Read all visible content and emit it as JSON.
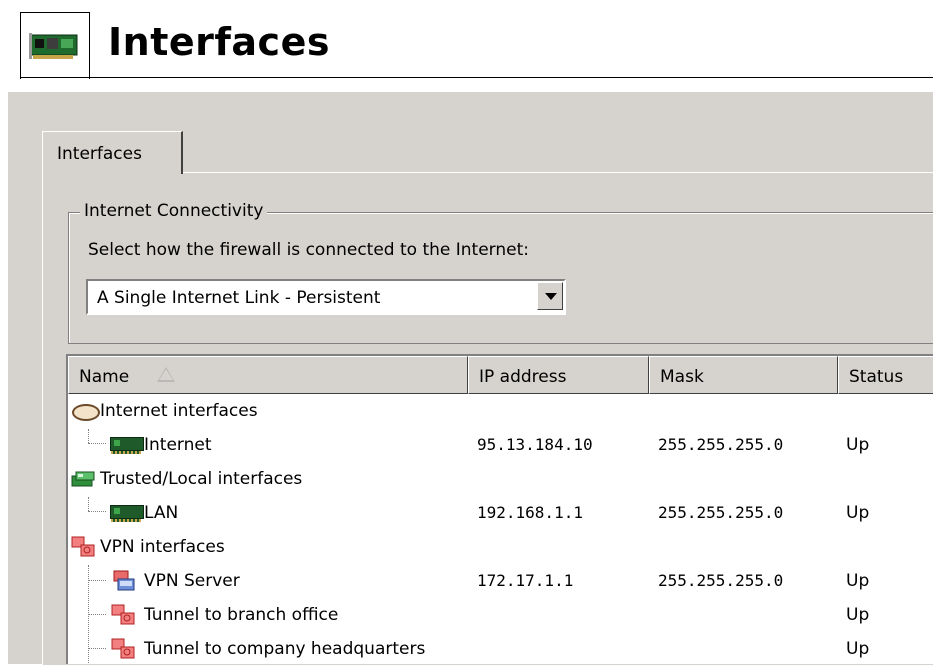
{
  "header": {
    "title": "Interfaces",
    "icon": "network-card-icon"
  },
  "tabs": [
    {
      "label": "Interfaces",
      "selected": true
    }
  ],
  "connectivity": {
    "legend": "Internet Connectivity",
    "prompt": "Select how the firewall is connected to the Internet:",
    "selected": "A Single Internet Link - Persistent"
  },
  "table": {
    "columns": [
      "Name",
      "IP address",
      "Mask",
      "Status"
    ],
    "sort": {
      "column": "Name",
      "direction": "ascending"
    },
    "rows": [
      {
        "name": "Internet interfaces",
        "ip": "",
        "mask": "",
        "status": "",
        "icon": "cloud-icon",
        "level": 0
      },
      {
        "name": "Internet",
        "ip": "95.13.184.10",
        "mask": "255.255.255.0",
        "status": "Up",
        "icon": "network-card-icon",
        "level": 1
      },
      {
        "name": "Trusted/Local interfaces",
        "ip": "",
        "mask": "",
        "status": "",
        "icon": "trusted-network-icon",
        "level": 0
      },
      {
        "name": "LAN",
        "ip": "192.168.1.1",
        "mask": "255.255.255.0",
        "status": "Up",
        "icon": "network-card-icon",
        "level": 1
      },
      {
        "name": "VPN interfaces",
        "ip": "",
        "mask": "",
        "status": "",
        "icon": "vpn-icon",
        "level": 0
      },
      {
        "name": "VPN Server",
        "ip": "172.17.1.1",
        "mask": "255.255.255.0",
        "status": "Up",
        "icon": "vpn-server-icon",
        "level": 1
      },
      {
        "name": "Tunnel to branch office",
        "ip": "",
        "mask": "",
        "status": "Up",
        "icon": "vpn-tunnel-icon",
        "level": 1
      },
      {
        "name": "Tunnel to company headquarters",
        "ip": "",
        "mask": "",
        "status": "Up",
        "icon": "vpn-tunnel-icon",
        "level": 1
      }
    ]
  }
}
